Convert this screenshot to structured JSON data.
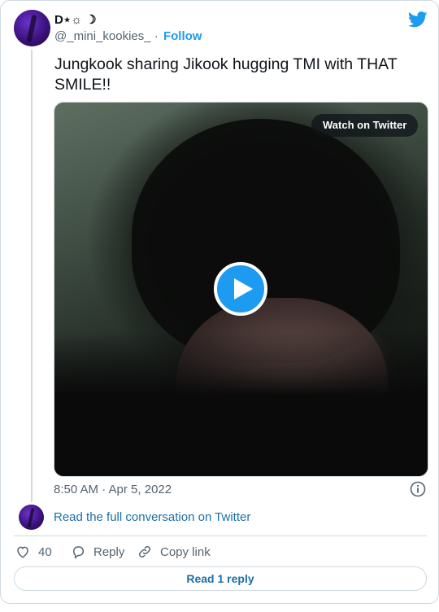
{
  "tweet": {
    "display_name": "D⋆☼ ☽",
    "handle": "@_mini_kookies_",
    "separator": "·",
    "follow_label": "Follow",
    "text": "Jungkook sharing Jikook hugging TMI with THAT SMILE!!",
    "timestamp": "8:50 AM · Apr 5, 2022"
  },
  "media": {
    "watch_label": "Watch on Twitter"
  },
  "conversation": {
    "read_full_label": "Read the full conversation on Twitter"
  },
  "actions": {
    "like_count": "40",
    "reply_label": "Reply",
    "copy_link_label": "Copy link"
  },
  "footer": {
    "read_replies_label": "Read 1 reply"
  },
  "colors": {
    "accent": "#1d9bf0",
    "link": "#1d6fa5",
    "muted_text": "#536471",
    "border": "#cfd9de"
  },
  "icons": [
    "twitter-bird-icon",
    "play-icon",
    "info-icon",
    "heart-icon",
    "reply-icon",
    "link-icon"
  ]
}
